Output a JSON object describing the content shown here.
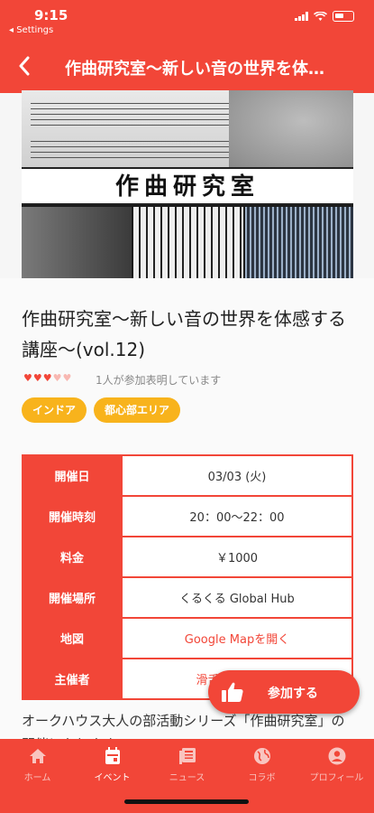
{
  "status_bar": {
    "time": "9:15",
    "back_app": "◂ Settings"
  },
  "nav": {
    "back_icon": "chevron-left-icon",
    "title": "作曲研究室〜新しい音の世界を体…"
  },
  "hero": {
    "banner_text": "作曲研究室"
  },
  "event": {
    "title": "作曲研究室〜新しい音の世界を体感する講座〜(vol.12)",
    "hearts_filled": 3,
    "hearts_total": 5,
    "participants_text": "1人が参加表明しています",
    "tags": [
      "インドア",
      "都心部エリア"
    ]
  },
  "info_rows": [
    {
      "label": "開催日",
      "value": "03/03 (火)"
    },
    {
      "label": "開催時刻",
      "value": "20：00〜22：00"
    },
    {
      "label": "料金",
      "value": "￥1000"
    },
    {
      "label": "開催場所",
      "value": "くるくる Global Hub"
    },
    {
      "label": "地図",
      "value": "Google Mapを開く"
    },
    {
      "label": "主催者",
      "value": "滑舌の良い支暦"
    }
  ],
  "description": "オークハウス大人の部活動シリーズ「作曲研究室」の開催になります。",
  "fab": {
    "label": "参加する",
    "icon": "thumbs-up-icon"
  },
  "tabs": [
    {
      "label": "ホーム",
      "icon": "home-icon"
    },
    {
      "label": "イベント",
      "icon": "calendar-icon"
    },
    {
      "label": "ニュース",
      "icon": "news-icon"
    },
    {
      "label": "コラボ",
      "icon": "globe-icon"
    },
    {
      "label": "プロフィール",
      "icon": "profile-icon"
    }
  ],
  "colors": {
    "primary": "#f24638",
    "tag": "#f8b31c"
  }
}
